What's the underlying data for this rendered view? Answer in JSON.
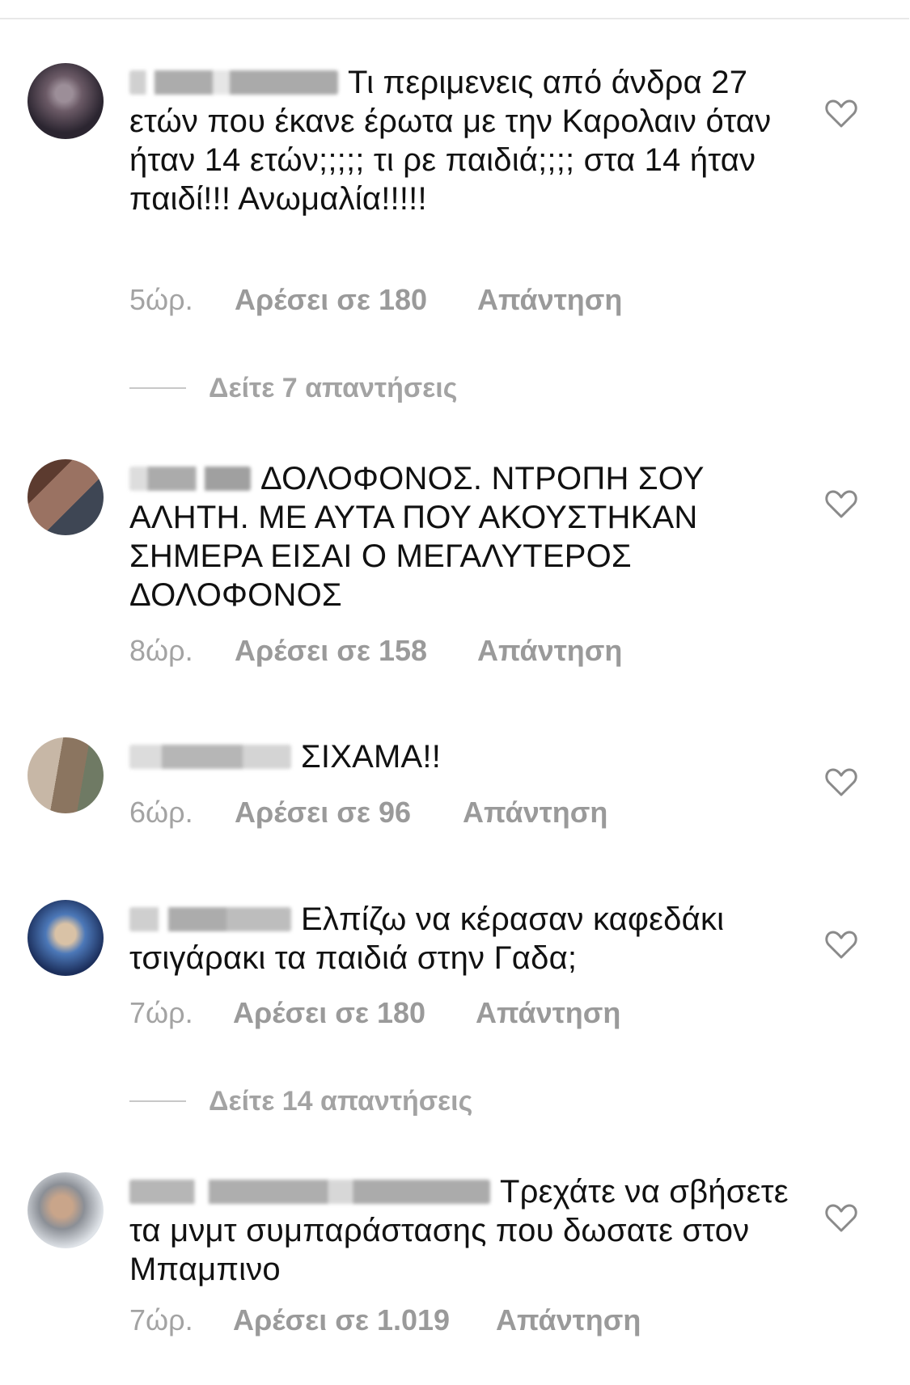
{
  "comments": [
    {
      "text": "Τι περιμενεις από άνδρα 27 ετών που έκανε έρωτα με την Καρολαιν όταν ήταν 14 ετών;;;;; τι ρε παιδιά;;;; στα 14 ήταν παιδί!!! Ανωμαλία!!!!!",
      "time": "5ώρ.",
      "likes": "Αρέσει σε 180",
      "reply": "Απάντηση",
      "avatar_colors": [
        "#2b2530",
        "#6b5a66",
        "#9c8e98"
      ],
      "username_color": "#7a7a7a",
      "view_replies": "Δείτε 7 απαντήσεις"
    },
    {
      "text": "ΔΟΛΟΦΟΝΟΣ. ΝΤΡΟΠΗ ΣΟΥ ΑΛΗΤΗ. ΜΕ ΑΥΤΑ ΠΟΥ ΑΚΟΥΣΤΗΚΑΝ ΣΗΜΕΡΑ ΕΙΣΑΙ Ο ΜΕΓΑΛΥΤΕΡΟΣ ΔΟΛΟΦΟΝΟΣ",
      "time": "8ώρ.",
      "likes": "Αρέσει σε 158",
      "reply": "Απάντηση",
      "avatar_colors": [
        "#5c3b2f",
        "#9a7262",
        "#3e4654"
      ],
      "username_color": "#8a8a8a",
      "view_replies": ""
    },
    {
      "text": "ΣΙΧΑΜΑ!!",
      "time": "6ώρ.",
      "likes": "Αρέσει σε 96",
      "reply": "Απάντηση",
      "avatar_colors": [
        "#c7b7a6",
        "#8b7560",
        "#6f7a64"
      ],
      "username_color": "#9a9a9a",
      "view_replies": ""
    },
    {
      "text": "Ελπίζω να κέρασαν καφεδάκι τσιγάρακι τα παιδιά στην Γαδα;",
      "time": "7ώρ.",
      "likes": "Αρέσει σε 180",
      "reply": "Απάντηση",
      "avatar_colors": [
        "#1c2f5c",
        "#4c78b8",
        "#d9c2a6"
      ],
      "username_color": "#8d8d8d",
      "view_replies": "Δείτε 14 απαντήσεις"
    },
    {
      "text": "Τρεχάτε να σβήσετε τα μνμτ συμπαράστασης που δωσατε στον Μπαμπινο",
      "time": "7ώρ.",
      "likes": "Αρέσει σε 1.019",
      "reply": "Απάντηση",
      "avatar_colors": [
        "#dfe3e8",
        "#8b8f96",
        "#c9a58a"
      ],
      "username_color": "#8a8a8a",
      "view_replies": ""
    }
  ]
}
